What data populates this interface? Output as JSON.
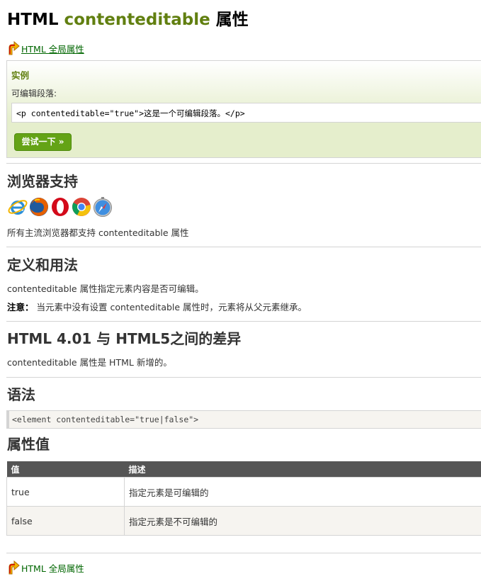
{
  "title": {
    "prefix": "HTML",
    "highlight": "contenteditable",
    "suffix": "属性"
  },
  "nav": {
    "top_link": "HTML 全局属性",
    "bottom_link": "HTML 全局属性"
  },
  "example": {
    "heading": "实例",
    "description": "可编辑段落:",
    "code": "<p contenteditable=\"true\">这是一个可编辑段落。</p>",
    "try_button": "尝试一下 »"
  },
  "browser_support": {
    "heading": "浏览器支持",
    "icons": [
      "internet-explorer-icon",
      "firefox-icon",
      "opera-icon",
      "chrome-icon",
      "safari-icon"
    ],
    "text": "所有主流浏览器都支持 contenteditable 属性"
  },
  "definition": {
    "heading": "定义和用法",
    "text": "contenteditable 属性指定元素内容是否可编辑。",
    "note_label": "注意：",
    "note_text": " 当元素中没有设置 contenteditable 属性时，元素将从父元素继承。"
  },
  "differences": {
    "heading": "HTML 4.01 与 HTML5之间的差异",
    "text": "contenteditable 属性是 HTML 新增的。"
  },
  "syntax": {
    "heading": "语法",
    "code": "<element contenteditable=\"true|false\">"
  },
  "values": {
    "heading": "属性值",
    "headers": [
      "值",
      "描述"
    ],
    "rows": [
      {
        "value": "true",
        "description": "指定元素是可编辑的"
      },
      {
        "value": "false",
        "description": "指定元素是不可编辑的"
      }
    ]
  },
  "colors": {
    "accent_green": "#617f10",
    "button_green": "#64a316",
    "link_green": "#006600",
    "table_header": "#555555"
  }
}
